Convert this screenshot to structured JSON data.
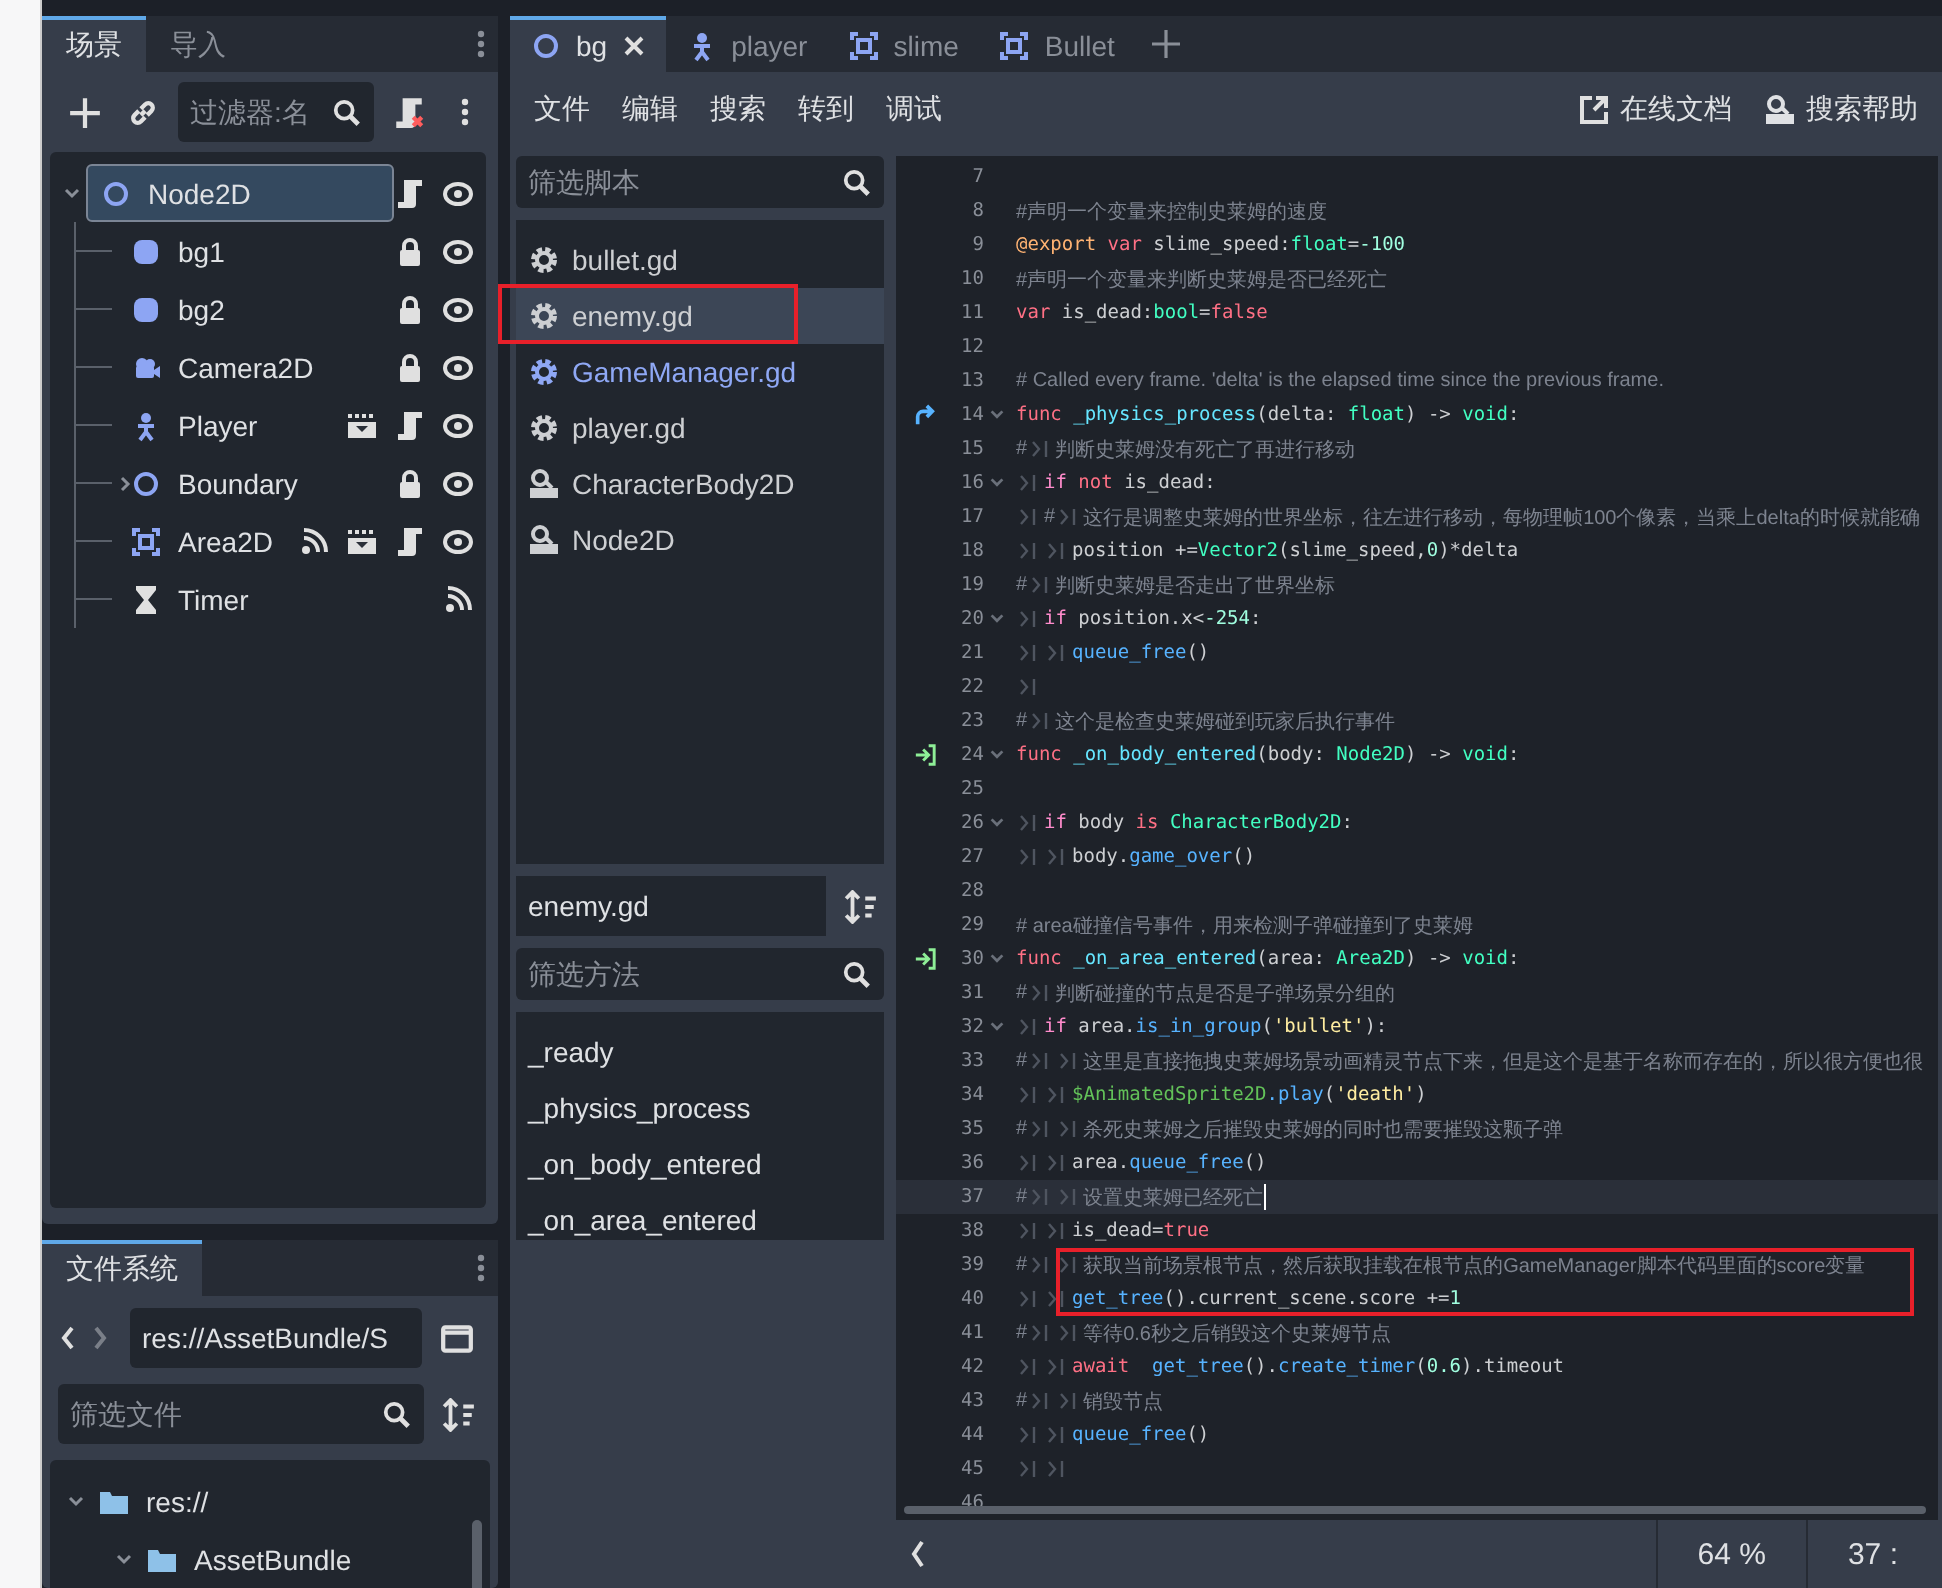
{
  "scene_dock": {
    "tabs": [
      {
        "label": "场景",
        "selected": true
      },
      {
        "label": "导入",
        "selected": false
      }
    ],
    "filter": {
      "placeholder": "过滤器:名"
    },
    "tree": [
      {
        "name": "Node2D",
        "kind": "node2d",
        "selected": true,
        "expanded": true,
        "script": true,
        "visible": true,
        "children": [
          {
            "name": "bg1",
            "kind": "sprite",
            "selected": false,
            "locked": true,
            "visible": true
          },
          {
            "name": "bg2",
            "kind": "sprite",
            "selected": false,
            "locked": true,
            "visible": true
          },
          {
            "name": "Camera2D",
            "kind": "camera",
            "selected": false,
            "locked": true,
            "visible": true
          },
          {
            "name": "Player",
            "kind": "character",
            "selected": false,
            "groups": true,
            "script": true,
            "visible": true
          },
          {
            "name": "Boundary",
            "kind": "node2d",
            "selected": false,
            "expanded": false,
            "locked": true,
            "visible": true
          },
          {
            "name": "Area2D",
            "kind": "area",
            "selected": false,
            "signals": true,
            "groups": true,
            "script": true,
            "visible": true
          },
          {
            "name": "Timer",
            "kind": "timer",
            "selected": false,
            "signals": true
          }
        ]
      }
    ]
  },
  "filesystem": {
    "tab": {
      "label": "文件系统",
      "selected": true
    },
    "path": "res://AssetBundle/S",
    "filter": {
      "placeholder": "筛选文件"
    },
    "tree": [
      {
        "name": "res://",
        "expanded": true,
        "children": [
          {
            "name": "AssetBundle",
            "expanded": true
          }
        ]
      }
    ]
  },
  "editor_tabs": [
    {
      "label": "bg",
      "kind": "node2d",
      "selected": true
    },
    {
      "label": "player",
      "kind": "character",
      "selected": false
    },
    {
      "label": "slime",
      "kind": "area",
      "selected": false
    },
    {
      "label": "Bullet",
      "kind": "area",
      "selected": false
    }
  ],
  "menu": [
    "文件",
    "编辑",
    "搜索",
    "转到",
    "调试"
  ],
  "help_links": [
    {
      "label": "在线文档",
      "kind": "external"
    },
    {
      "label": "搜索帮助",
      "kind": "doc"
    }
  ],
  "scripts": {
    "filter": {
      "placeholder": "筛选脚本"
    },
    "items": [
      {
        "name": "bullet.gd",
        "kind": "script",
        "selected": false,
        "boxed": false,
        "color": "#cdcfd2"
      },
      {
        "name": "enemy.gd",
        "kind": "script",
        "selected": true,
        "boxed": true,
        "color": "#cdcfd2"
      },
      {
        "name": "GameManager.gd",
        "kind": "script",
        "selected": false,
        "boxed": false,
        "color": "#8fa8f5"
      },
      {
        "name": "player.gd",
        "kind": "script",
        "selected": false,
        "boxed": false,
        "color": "#cdcfd2"
      },
      {
        "name": "CharacterBody2D",
        "kind": "doc",
        "selected": false,
        "boxed": false,
        "color": "#cdcfd2"
      },
      {
        "name": "Node2D",
        "kind": "doc",
        "selected": false,
        "boxed": false,
        "color": "#cdcfd2"
      }
    ]
  },
  "current_script": "enemy.gd",
  "methods": {
    "filter": {
      "placeholder": "筛选方法"
    },
    "items": [
      "_ready",
      "_physics_process",
      "_on_body_entered",
      "_on_area_entered"
    ]
  },
  "code": [
    {
      "n": "7"
    },
    {
      "n": "8",
      "t": [
        {
          "kind": "comment",
          "text": "#声明一个变量来控制史莱姆的速度"
        }
      ]
    },
    {
      "n": "9",
      "t": [
        {
          "kind": "annotation",
          "text": "@export"
        },
        {
          "kind": "keyword",
          "text": " var"
        },
        {
          "kind": "plain",
          "text": " slime_speed:"
        },
        {
          "kind": "type",
          "text": "float"
        },
        {
          "kind": "plain",
          "text": "="
        },
        {
          "kind": "number",
          "text": "-100"
        }
      ]
    },
    {
      "n": "10",
      "t": [
        {
          "kind": "comment",
          "text": "#声明一个变量来判断史莱姆是否已经死亡"
        }
      ]
    },
    {
      "n": "11",
      "t": [
        {
          "kind": "keyword",
          "text": "var"
        },
        {
          "kind": "plain",
          "text": " is_dead:"
        },
        {
          "kind": "type",
          "text": "bool"
        },
        {
          "kind": "plain",
          "text": "="
        },
        {
          "kind": "keyword",
          "text": "false"
        }
      ]
    },
    {
      "n": "12"
    },
    {
      "n": "13",
      "t": [
        {
          "kind": "comment",
          "text": "# Called every frame. 'delta' is the elapsed time since the previous frame."
        }
      ]
    },
    {
      "n": "14",
      "overrides": true,
      "fold": true,
      "t": [
        {
          "kind": "keyword",
          "text": "func"
        },
        {
          "kind": "funcname",
          "text": " _physics_process"
        },
        {
          "kind": "plain",
          "text": "(delta: "
        },
        {
          "kind": "type",
          "text": "float"
        },
        {
          "kind": "plain",
          "text": ") -> "
        },
        {
          "kind": "type",
          "text": "void"
        },
        {
          "kind": "plain",
          "text": ":"
        }
      ]
    },
    {
      "n": "15",
      "t": [
        {
          "kind": "comment",
          "text": "#"
        },
        {
          "kind": "tab"
        },
        {
          "kind": "comment",
          "text": "判断史莱姆没有死亡了再进行移动"
        }
      ]
    },
    {
      "n": "16",
      "fold": true,
      "t": [
        {
          "kind": "tab"
        },
        {
          "kind": "control",
          "text": "if"
        },
        {
          "kind": "keyword",
          "text": " not"
        },
        {
          "kind": "plain",
          "text": " is_dead:"
        }
      ]
    },
    {
      "n": "17",
      "t": [
        {
          "kind": "tab"
        },
        {
          "kind": "comment",
          "text": "#"
        },
        {
          "kind": "tab"
        },
        {
          "kind": "comment",
          "text": "这行是调整史莱姆的世界坐标，往左进行移动，每物理帧100个像素，当乘上delta的时候就能确"
        }
      ]
    },
    {
      "n": "18",
      "t": [
        {
          "kind": "tab"
        },
        {
          "kind": "tab"
        },
        {
          "kind": "plain",
          "text": "position +="
        },
        {
          "kind": "type",
          "text": "Vector2"
        },
        {
          "kind": "plain",
          "text": "(slime_speed,"
        },
        {
          "kind": "number",
          "text": "0"
        },
        {
          "kind": "plain",
          "text": ")*delta"
        }
      ]
    },
    {
      "n": "19",
      "t": [
        {
          "kind": "comment",
          "text": "#"
        },
        {
          "kind": "tab"
        },
        {
          "kind": "comment",
          "text": "判断史莱姆是否走出了世界坐标"
        }
      ]
    },
    {
      "n": "20",
      "fold": true,
      "t": [
        {
          "kind": "tab"
        },
        {
          "kind": "control",
          "text": "if"
        },
        {
          "kind": "plain",
          "text": " position.x<"
        },
        {
          "kind": "number",
          "text": "-254"
        },
        {
          "kind": "plain",
          "text": ":"
        }
      ]
    },
    {
      "n": "21",
      "t": [
        {
          "kind": "tab"
        },
        {
          "kind": "tab"
        },
        {
          "kind": "function",
          "text": "queue_free"
        },
        {
          "kind": "plain",
          "text": "()"
        }
      ]
    },
    {
      "n": "22",
      "t": [
        {
          "kind": "tab"
        }
      ]
    },
    {
      "n": "23",
      "t": [
        {
          "kind": "comment",
          "text": "#"
        },
        {
          "kind": "tab"
        },
        {
          "kind": "comment",
          "text": "这个是检查史莱姆碰到玩家后执行事件"
        }
      ]
    },
    {
      "n": "24",
      "connected": true,
      "fold": true,
      "t": [
        {
          "kind": "keyword",
          "text": "func"
        },
        {
          "kind": "funcname",
          "text": " _on_body_entered"
        },
        {
          "kind": "plain",
          "text": "(body: "
        },
        {
          "kind": "type",
          "text": "Node2D"
        },
        {
          "kind": "plain",
          "text": ") -> "
        },
        {
          "kind": "type",
          "text": "void"
        },
        {
          "kind": "plain",
          "text": ":"
        }
      ]
    },
    {
      "n": "25"
    },
    {
      "n": "26",
      "fold": true,
      "t": [
        {
          "kind": "tab"
        },
        {
          "kind": "control",
          "text": "if"
        },
        {
          "kind": "plain",
          "text": " body"
        },
        {
          "kind": "keyword",
          "text": " is"
        },
        {
          "kind": "type",
          "text": " CharacterBody2D"
        },
        {
          "kind": "plain",
          "text": ":"
        }
      ]
    },
    {
      "n": "27",
      "t": [
        {
          "kind": "tab"
        },
        {
          "kind": "tab"
        },
        {
          "kind": "plain",
          "text": "body."
        },
        {
          "kind": "function",
          "text": "game_over"
        },
        {
          "kind": "plain",
          "text": "()"
        }
      ]
    },
    {
      "n": "28"
    },
    {
      "n": "29",
      "t": [
        {
          "kind": "comment",
          "text": "# area碰撞信号事件，用来检测子弹碰撞到了史莱姆"
        }
      ]
    },
    {
      "n": "30",
      "connected": true,
      "fold": true,
      "t": [
        {
          "kind": "keyword",
          "text": "func"
        },
        {
          "kind": "funcname",
          "text": " _on_area_entered"
        },
        {
          "kind": "plain",
          "text": "(area: "
        },
        {
          "kind": "type",
          "text": "Area2D"
        },
        {
          "kind": "plain",
          "text": ") -> "
        },
        {
          "kind": "type",
          "text": "void"
        },
        {
          "kind": "plain",
          "text": ":"
        }
      ]
    },
    {
      "n": "31",
      "t": [
        {
          "kind": "comment",
          "text": "#"
        },
        {
          "kind": "tab"
        },
        {
          "kind": "comment",
          "text": "判断碰撞的节点是否是子弹场景分组的"
        }
      ]
    },
    {
      "n": "32",
      "fold": true,
      "t": [
        {
          "kind": "tab"
        },
        {
          "kind": "control",
          "text": "if"
        },
        {
          "kind": "plain",
          "text": " area."
        },
        {
          "kind": "function",
          "text": "is_in_group"
        },
        {
          "kind": "plain",
          "text": "("
        },
        {
          "kind": "string",
          "text": "'bullet'"
        },
        {
          "kind": "plain",
          "text": "):"
        }
      ]
    },
    {
      "n": "33",
      "t": [
        {
          "kind": "comment",
          "text": "#"
        },
        {
          "kind": "tab"
        },
        {
          "kind": "tab"
        },
        {
          "kind": "comment",
          "text": "这里是直接拖拽史莱姆场景动画精灵节点下来，但是这个是基于名称而存在的，所以很方便也很"
        }
      ]
    },
    {
      "n": "34",
      "t": [
        {
          "kind": "tab"
        },
        {
          "kind": "tab"
        },
        {
          "kind": "nodepath",
          "text": "$AnimatedSprite2D"
        },
        {
          "kind": "function",
          "text": ".play"
        },
        {
          "kind": "plain",
          "text": "("
        },
        {
          "kind": "string",
          "text": "'death'"
        },
        {
          "kind": "plain",
          "text": ")"
        }
      ]
    },
    {
      "n": "35",
      "t": [
        {
          "kind": "comment",
          "text": "#"
        },
        {
          "kind": "tab"
        },
        {
          "kind": "tab"
        },
        {
          "kind": "comment",
          "text": "杀死史莱姆之后摧毁史莱姆的同时也需要摧毁这颗子弹"
        }
      ]
    },
    {
      "n": "36",
      "t": [
        {
          "kind": "tab"
        },
        {
          "kind": "tab"
        },
        {
          "kind": "plain",
          "text": "area."
        },
        {
          "kind": "function",
          "text": "queue_free"
        },
        {
          "kind": "plain",
          "text": "()"
        }
      ]
    },
    {
      "n": "37",
      "current": true,
      "t": [
        {
          "kind": "comment",
          "text": "#"
        },
        {
          "kind": "tab"
        },
        {
          "kind": "tab"
        },
        {
          "kind": "comment",
          "text": "设置史莱姆已经死亡"
        }
      ]
    },
    {
      "n": "38",
      "t": [
        {
          "kind": "tab"
        },
        {
          "kind": "tab"
        },
        {
          "kind": "plain",
          "text": "is_dead="
        },
        {
          "kind": "keyword",
          "text": "true"
        }
      ]
    },
    {
      "n": "39",
      "boxed": true,
      "t": [
        {
          "kind": "comment",
          "text": "#"
        },
        {
          "kind": "tab"
        },
        {
          "kind": "tab"
        },
        {
          "kind": "comment",
          "text": "获取当前场景根节点，然后获取挂载在根节点的GameManager脚本代码里面的score变量"
        }
      ]
    },
    {
      "n": "40",
      "boxed": true,
      "t": [
        {
          "kind": "tab"
        },
        {
          "kind": "tab"
        },
        {
          "kind": "function",
          "text": "get_tree"
        },
        {
          "kind": "plain",
          "text": "().current_scene.score +="
        },
        {
          "kind": "number",
          "text": "1"
        }
      ]
    },
    {
      "n": "41",
      "t": [
        {
          "kind": "comment",
          "text": "#"
        },
        {
          "kind": "tab"
        },
        {
          "kind": "tab"
        },
        {
          "kind": "comment",
          "text": "等待0.6秒之后销毁这个史莱姆节点"
        }
      ]
    },
    {
      "n": "42",
      "t": [
        {
          "kind": "tab"
        },
        {
          "kind": "tab"
        },
        {
          "kind": "keyword",
          "text": "await"
        },
        {
          "kind": "function",
          "text": "  get_tree"
        },
        {
          "kind": "plain",
          "text": "()."
        },
        {
          "kind": "function",
          "text": "create_timer"
        },
        {
          "kind": "plain",
          "text": "("
        },
        {
          "kind": "number",
          "text": "0.6"
        },
        {
          "kind": "plain",
          "text": ").timeout"
        }
      ]
    },
    {
      "n": "43",
      "t": [
        {
          "kind": "comment",
          "text": "#"
        },
        {
          "kind": "tab"
        },
        {
          "kind": "tab"
        },
        {
          "kind": "comment",
          "text": "销毁节点"
        }
      ]
    },
    {
      "n": "44",
      "t": [
        {
          "kind": "tab"
        },
        {
          "kind": "tab"
        },
        {
          "kind": "function",
          "text": "queue_free"
        },
        {
          "kind": "plain",
          "text": "()"
        }
      ]
    },
    {
      "n": "45",
      "t": [
        {
          "kind": "tab"
        },
        {
          "kind": "tab"
        }
      ]
    },
    {
      "n": "46"
    }
  ],
  "status": {
    "zoom": "64 %",
    "position": "37 :"
  }
}
